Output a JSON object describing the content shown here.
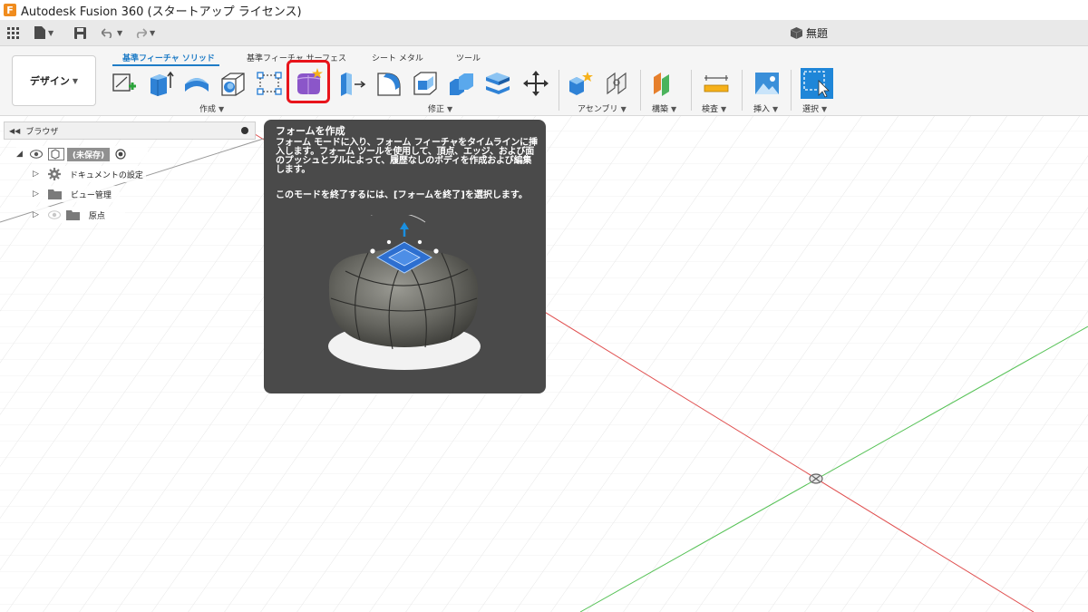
{
  "window": {
    "title": "Autodesk Fusion 360 (スタートアップ ライセンス)",
    "logo_letter": "F"
  },
  "document": {
    "title": "無題"
  },
  "ribbon": {
    "workspace_label": "デザイン",
    "tabs": [
      {
        "label": "基準フィーチャ ソリッド",
        "active": true
      },
      {
        "label": "基準フィーチャ サーフェス"
      },
      {
        "label": "シート メタル"
      },
      {
        "label": "ツール"
      }
    ],
    "groups": {
      "create": "作成",
      "modify": "修正",
      "assemble": "アセンブリ",
      "construct": "構築",
      "inspect": "検査",
      "insert": "挿入",
      "select": "選択"
    }
  },
  "browser": {
    "title": "ブラウザ",
    "root_label": "(未保存)",
    "items": [
      {
        "label": "ドキュメントの設定"
      },
      {
        "label": "ビュー管理"
      },
      {
        "label": "原点"
      }
    ]
  },
  "tooltip": {
    "title": "フォームを作成",
    "description": "フォーム モードに入り、フォーム フィーチャをタイムラインに挿入します。フォーム ツールを使用して、頂点、エッジ、および面のプッシュとプルによって、履歴なしのボディを作成および編集します。",
    "exit_hint": "このモードを終了するには、[フォームを終了]を選択します。"
  },
  "colors": {
    "accent": "#1f7cc6",
    "highlight": "#e8141b",
    "tooltip_bg": "#4a4a4a",
    "axis_x": "#e05050",
    "axis_y": "#57c257"
  }
}
